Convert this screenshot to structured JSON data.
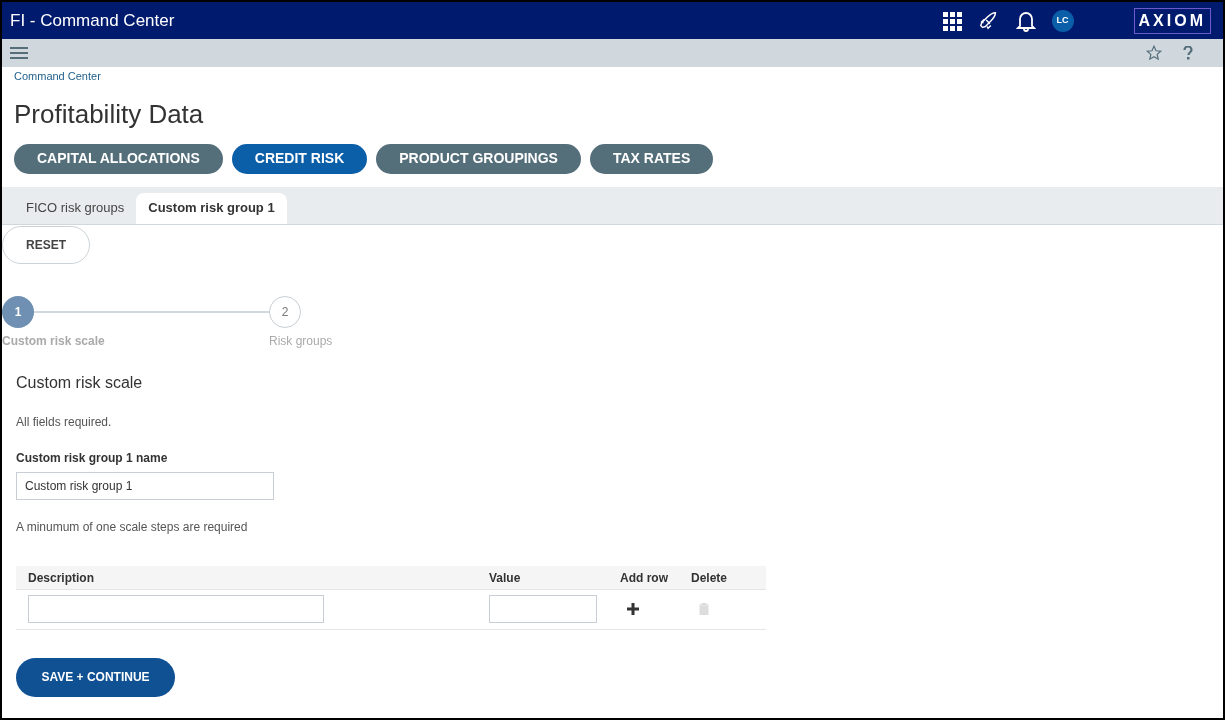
{
  "header": {
    "title": "FI - Command Center",
    "avatar": "LC",
    "logo": "AXIOM"
  },
  "breadcrumb": "Command Center",
  "page_title": "Profitability Data",
  "nav_buttons": [
    {
      "label": "CAPITAL ALLOCATIONS",
      "selected": false
    },
    {
      "label": "CREDIT RISK",
      "selected": true
    },
    {
      "label": "PRODUCT GROUPINGS",
      "selected": false
    },
    {
      "label": "TAX RATES",
      "selected": false
    }
  ],
  "tabs": [
    {
      "label": "FICO risk groups",
      "selected": false
    },
    {
      "label": "Custom risk group 1",
      "selected": true
    }
  ],
  "reset_button": "RESET",
  "steps": [
    {
      "number": "1",
      "label": "Custom risk scale",
      "active": true
    },
    {
      "number": "2",
      "label": "Risk groups",
      "active": false
    }
  ],
  "section_title": "Custom risk scale",
  "required_note": "All fields required.",
  "name_field": {
    "label": "Custom risk group 1 name",
    "value": "Custom risk group 1"
  },
  "scale_note": "A minumum of one scale steps are required",
  "table": {
    "columns": [
      "Description",
      "Value",
      "Add row",
      "Delete"
    ],
    "rows": [
      {
        "description": "",
        "value": "",
        "delete_disabled": true
      }
    ]
  },
  "save_button": "SAVE + CONTINUE"
}
